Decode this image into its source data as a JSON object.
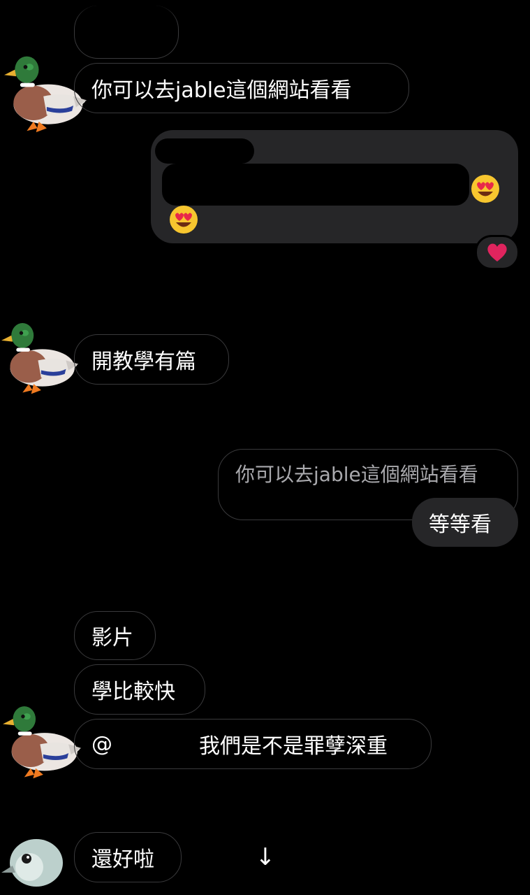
{
  "messages": {
    "received_1": "你可以去jable這個網站看看",
    "received_2": "開教學有篇",
    "reply_quote": "你可以去jable這個網站看看",
    "sent_reply": "等等看",
    "received_3": "影片",
    "received_4": "學比較快",
    "received_5_mention": "@",
    "received_5_text": "我們是不是罪孽深重",
    "received_6": "還好啦"
  },
  "icons": {
    "avatar": "mallard-duck-avatar",
    "reaction": "red-heart-icon",
    "emoji": "heart-eyes-emoji",
    "scroll": "arrow-down-icon",
    "last_avatar": "bird-head-avatar"
  },
  "scroll_arrow": "↓",
  "colors": {
    "background": "#000000",
    "bubble_outline": "#3a3a3c",
    "bubble_fill": "#262628",
    "text": "#ffffff",
    "quoted_text": "#a9a9ad",
    "heart": "#e0245e"
  }
}
